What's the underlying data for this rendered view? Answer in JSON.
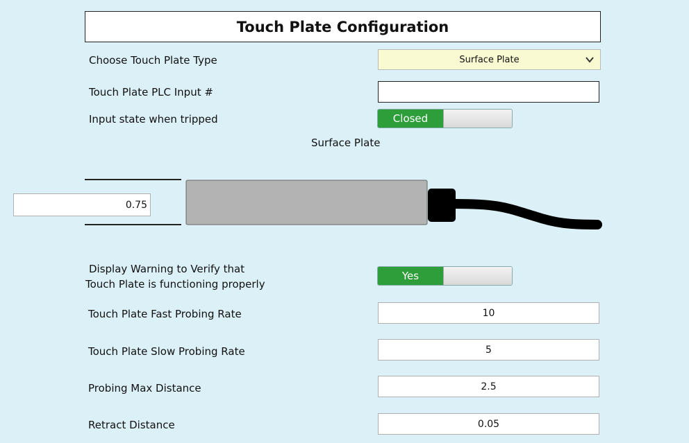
{
  "header": {
    "title": "Touch Plate Configuration"
  },
  "plate_type": {
    "label": "Choose Touch Plate Type",
    "selected": "Surface Plate"
  },
  "plc_input": {
    "label": "Touch Plate PLC Input #",
    "value": ""
  },
  "input_state": {
    "label": "Input state when tripped",
    "value": "Closed",
    "on": true
  },
  "diagram": {
    "caption": "Surface Plate",
    "thickness": "0.75"
  },
  "warning": {
    "label_line1": "Display Warning to Verify that",
    "label_line2": "Touch Plate is functioning properly",
    "value": "Yes",
    "on": true
  },
  "fast_rate": {
    "label": "Touch Plate Fast Probing Rate",
    "value": "10"
  },
  "slow_rate": {
    "label": "Touch Plate Slow Probing Rate",
    "value": "5"
  },
  "max_distance": {
    "label": "Probing Max Distance",
    "value": "2.5"
  },
  "retract": {
    "label": "Retract Distance",
    "value": "0.05"
  },
  "colors": {
    "background": "#dbf0f7",
    "toggle_on": "#2e9e3b",
    "dropdown_bg": "#fafad2"
  }
}
